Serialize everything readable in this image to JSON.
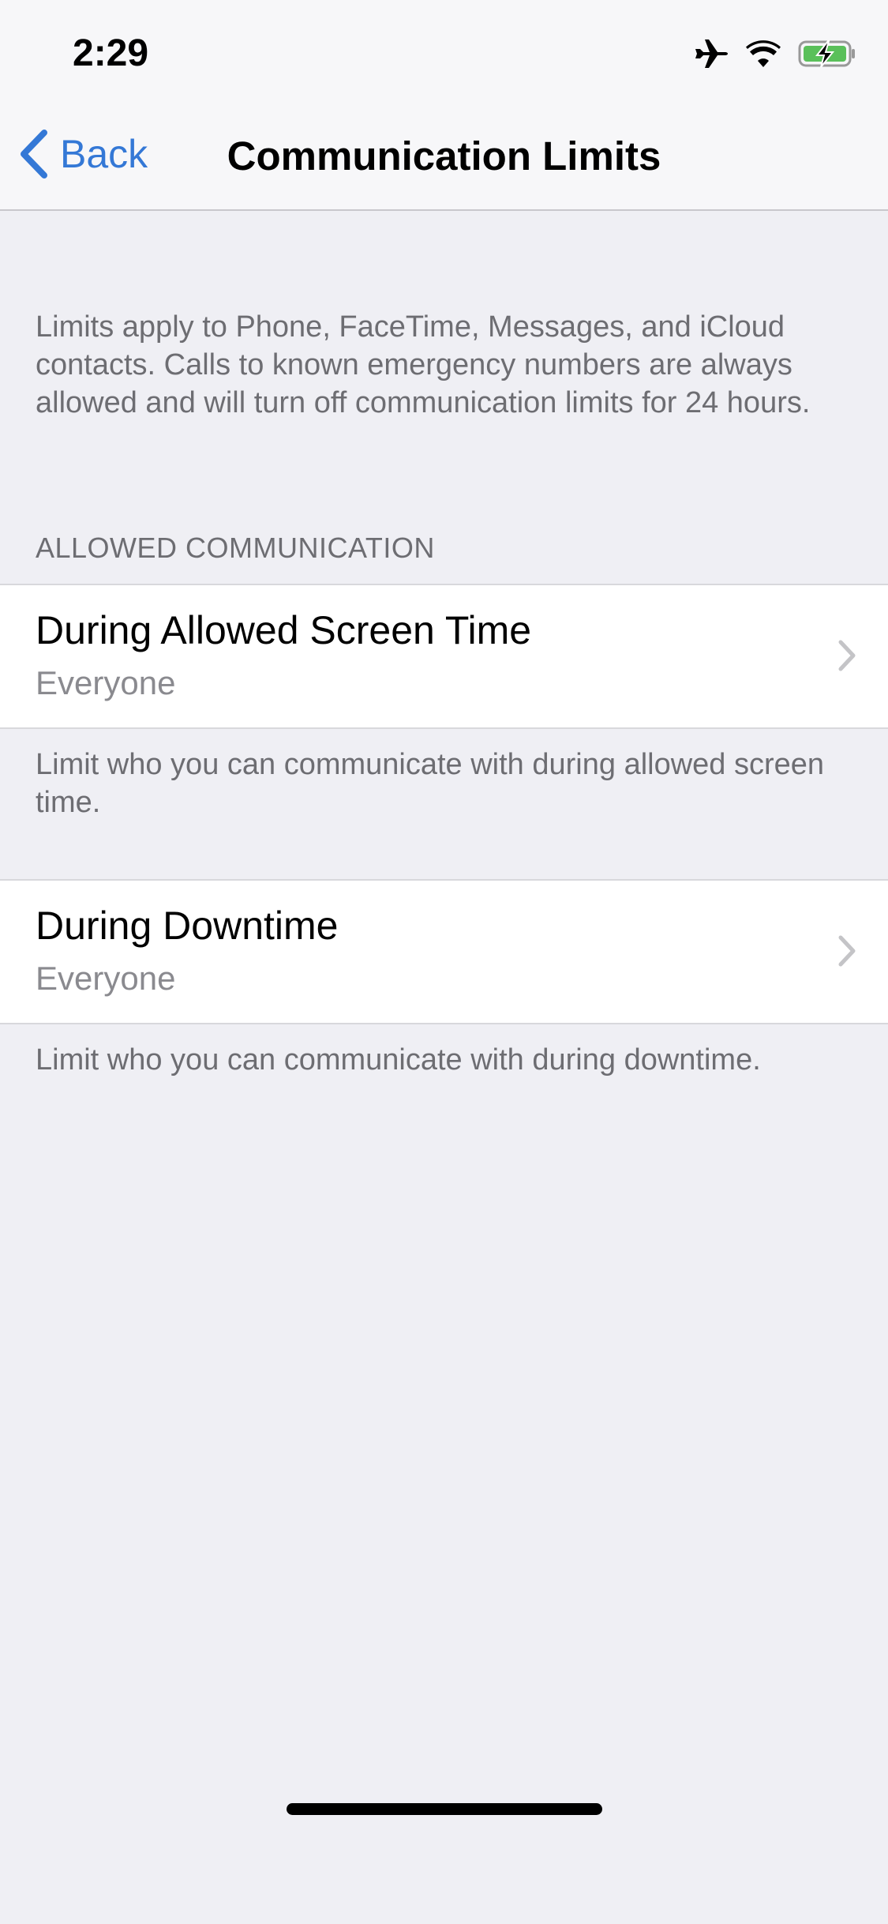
{
  "status_bar": {
    "time": "2:29",
    "icons": [
      "airplane-icon",
      "wifi-icon",
      "battery-charging-icon"
    ],
    "battery_color": "#5ac05a"
  },
  "nav": {
    "back_label": "Back",
    "title": "Communication Limits",
    "accent": "#3478d6"
  },
  "description": "Limits apply to Phone, FaceTime, Messages, and iCloud contacts. Calls to known emergency numbers are always allowed and will turn off communication limits for 24 hours.",
  "section": {
    "header": "ALLOWED COMMUNICATION"
  },
  "cells": [
    {
      "title": "During Allowed Screen Time",
      "value": "Everyone",
      "footer": "Limit who you can communicate with during allowed screen time."
    },
    {
      "title": "During Downtime",
      "value": "Everyone",
      "footer": "Limit who you can communicate with during downtime."
    }
  ]
}
